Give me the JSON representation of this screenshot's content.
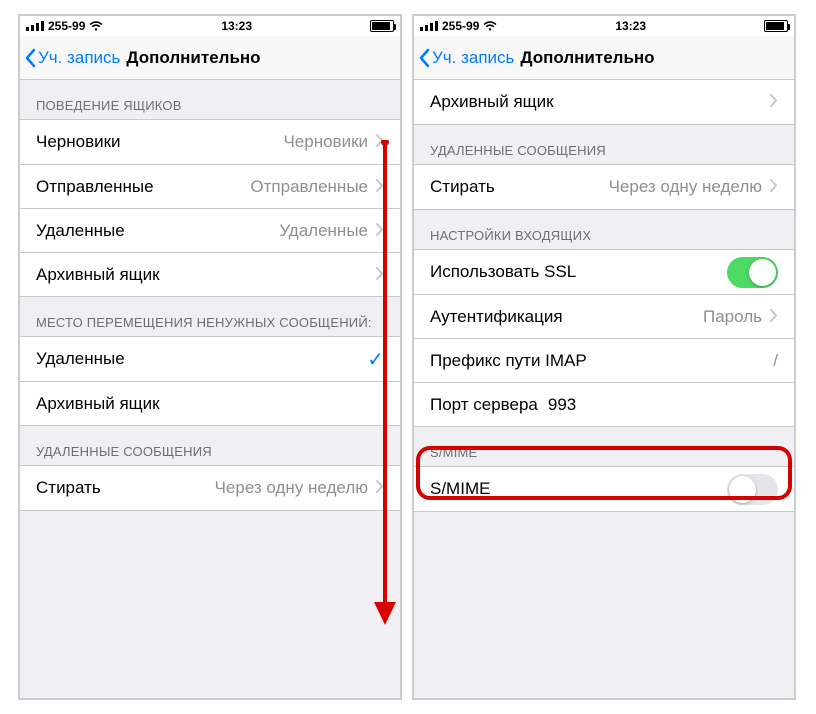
{
  "status": {
    "carrier": "255-99",
    "time": "13:23"
  },
  "nav": {
    "back": "Уч. запись",
    "title": "Дополнительно"
  },
  "left": {
    "sections": {
      "mailbox_behaviors": "ПОВЕДЕНИЕ ЯЩИКОВ",
      "drafts_label": "Черновики",
      "drafts_value": "Черновики",
      "sent_label": "Отправленные",
      "sent_value": "Отправленные",
      "deleted_label": "Удаленные",
      "deleted_value": "Удаленные",
      "archive_label": "Архивный ящик",
      "move_header": "МЕСТО ПЕРЕМЕЩЕНИЯ НЕНУЖНЫХ СООБЩЕНИЙ:",
      "opt_deleted": "Удаленные",
      "opt_archive": "Архивный ящик",
      "deleted_msgs_header": "УДАЛЕННЫЕ СООБЩЕНИЯ",
      "erase_label": "Стирать",
      "erase_value": "Через одну неделю"
    }
  },
  "right": {
    "archive_label": "Архивный ящик",
    "deleted_msgs_header": "УДАЛЕННЫЕ СООБЩЕНИЯ",
    "erase_label": "Стирать",
    "erase_value": "Через одну неделю",
    "incoming_header": "НАСТРОЙКИ ВХОДЯЩИХ",
    "ssl_label": "Использовать SSL",
    "auth_label": "Аутентификация",
    "auth_value": "Пароль",
    "imap_prefix_label": "Префикс пути IMAP",
    "imap_prefix_value": "/",
    "server_port_label": "Порт сервера",
    "server_port_value": "993",
    "smime_header": "S/MIME",
    "smime_label": "S/MIME"
  }
}
